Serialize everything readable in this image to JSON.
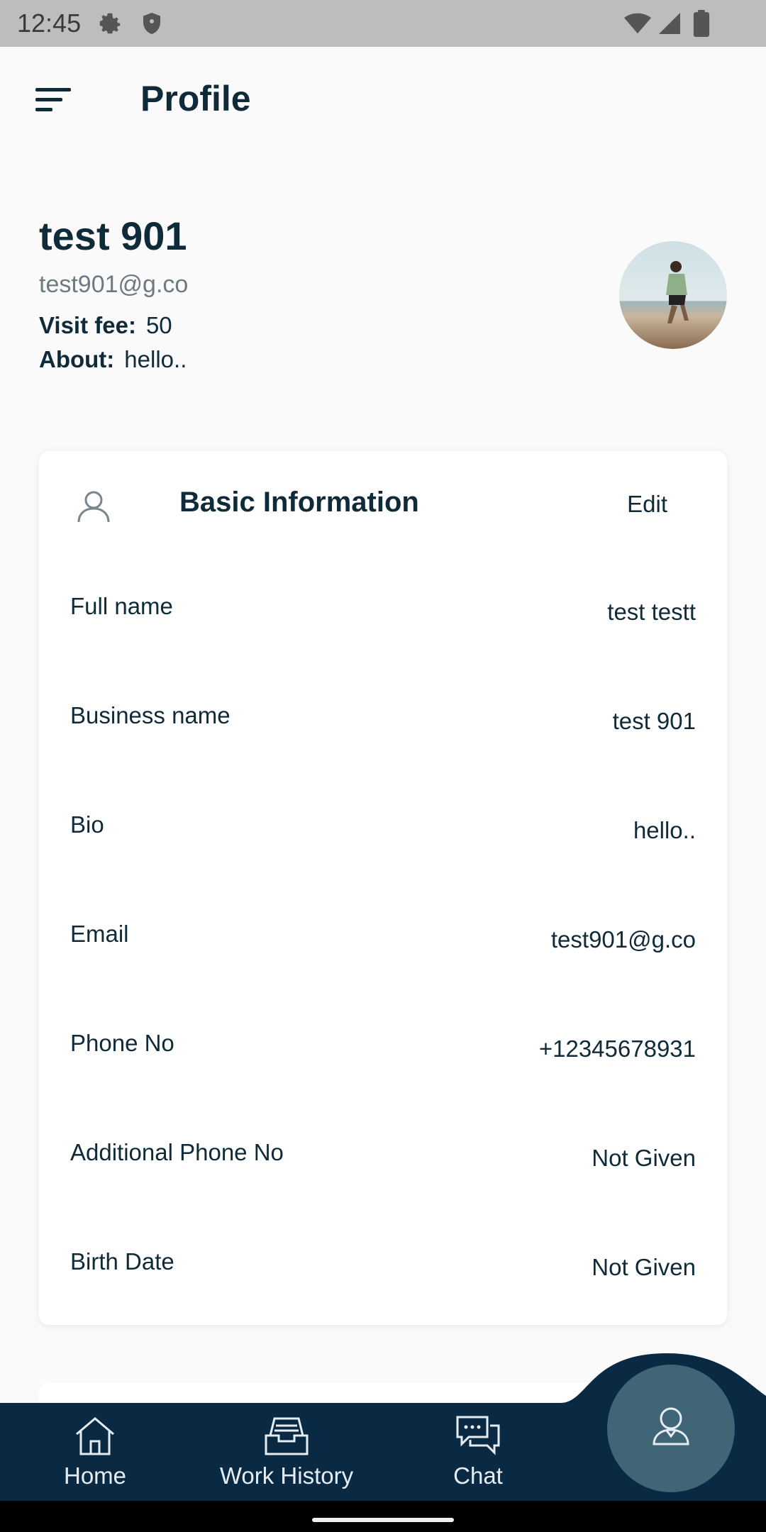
{
  "status_bar": {
    "time": "12:45"
  },
  "app_bar": {
    "title": "Profile"
  },
  "profile": {
    "name": "test 901",
    "email": "test901@g.co",
    "visit_fee_label": "Visit fee:",
    "visit_fee_value": "50",
    "about_label": "About:",
    "about_value": "hello.."
  },
  "basic_info": {
    "title": "Basic Information",
    "edit_label": "Edit",
    "rows": [
      {
        "label": "Full name",
        "value": "test testt"
      },
      {
        "label": "Business name",
        "value": "test 901"
      },
      {
        "label": "Bio",
        "value": "hello.."
      },
      {
        "label": "Email",
        "value": "test901@g.co"
      },
      {
        "label": "Phone No",
        "value": "+12345678931"
      },
      {
        "label": "Additional Phone No",
        "value": "Not Given"
      },
      {
        "label": "Birth Date",
        "value": "Not Given"
      }
    ]
  },
  "bottom_nav": {
    "items": [
      {
        "label": "Home",
        "icon": "home-icon"
      },
      {
        "label": "Work History",
        "icon": "inbox-tray-icon"
      },
      {
        "label": "Chat",
        "icon": "chat-bubbles-icon"
      }
    ],
    "active_icon": "person-icon"
  },
  "colors": {
    "primary_dark": "#0a2a44",
    "fab": "#3f6577",
    "text_dark": "#0f2a38",
    "text_muted": "#6d7a82",
    "background": "#fafafa"
  }
}
